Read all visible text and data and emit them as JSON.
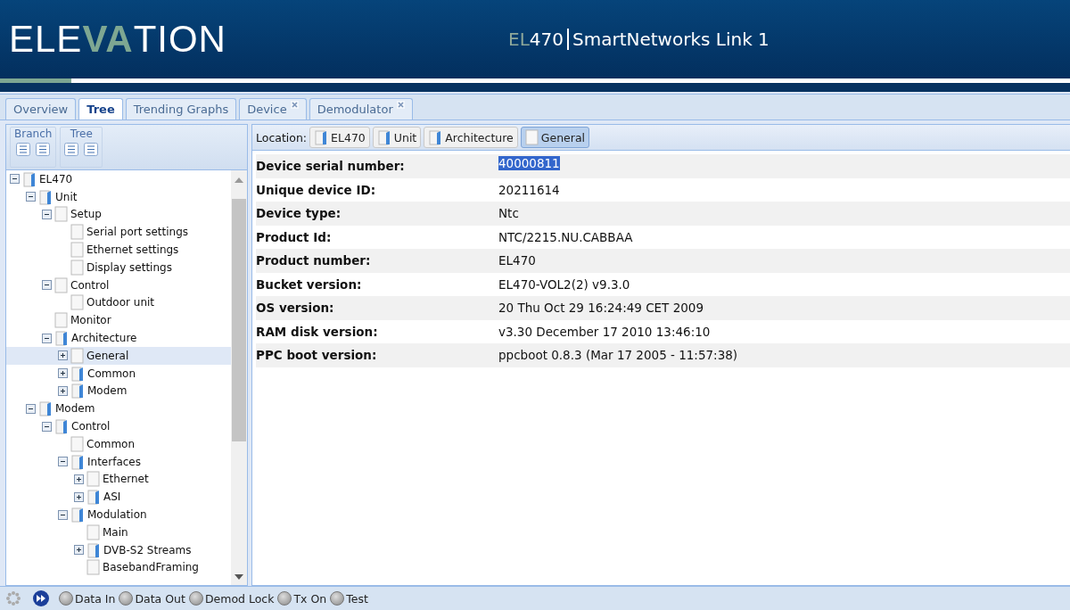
{
  "header": {
    "logo": [
      {
        "text": "ELE",
        "accent": false
      },
      {
        "text": "VA",
        "accent": true
      },
      {
        "text": "TION",
        "accent": false
      }
    ],
    "product": [
      {
        "text": "EL",
        "accent": true
      },
      {
        "text": "470",
        "accent": false
      }
    ],
    "title": "SmartNetworks Link 1"
  },
  "tabs": [
    {
      "label": "Overview",
      "selected": false,
      "closable": false
    },
    {
      "label": "Tree",
      "selected": true,
      "closable": false
    },
    {
      "label": "Trending Graphs",
      "selected": false,
      "closable": false
    },
    {
      "label": "Device",
      "selected": false,
      "closable": true
    },
    {
      "label": "Demodulator",
      "selected": false,
      "closable": true
    }
  ],
  "toolbar_groups": [
    {
      "label": "Branch"
    },
    {
      "label": "Tree"
    }
  ],
  "tree": [
    {
      "label": "EL470",
      "kind": "folder",
      "expanded": true,
      "selected": false,
      "children": [
        {
          "label": "Unit",
          "kind": "folder",
          "expanded": true,
          "selected": false,
          "children": [
            {
              "label": "Setup",
              "kind": "page",
              "expanded": true,
              "selected": false,
              "children": [
                {
                  "label": "Serial port settings",
                  "kind": "page",
                  "selected": false
                },
                {
                  "label": "Ethernet settings",
                  "kind": "page",
                  "selected": false
                },
                {
                  "label": "Display settings",
                  "kind": "page",
                  "selected": false
                }
              ]
            },
            {
              "label": "Control",
              "kind": "page",
              "expanded": true,
              "selected": false,
              "children": [
                {
                  "label": "Outdoor unit",
                  "kind": "page",
                  "selected": false
                }
              ]
            },
            {
              "label": "Monitor",
              "kind": "page",
              "selected": false
            },
            {
              "label": "Architecture",
              "kind": "folder",
              "expanded": true,
              "selected": false,
              "children": [
                {
                  "label": "General",
                  "kind": "page",
                  "expanded": false,
                  "selected": true
                },
                {
                  "label": "Common",
                  "kind": "folder",
                  "expanded": false,
                  "selected": false
                },
                {
                  "label": "Modem",
                  "kind": "folder",
                  "expanded": false,
                  "selected": false
                }
              ]
            }
          ]
        },
        {
          "label": "Modem",
          "kind": "folder",
          "expanded": true,
          "selected": false,
          "children": [
            {
              "label": "Control",
              "kind": "folder",
              "expanded": true,
              "selected": false,
              "children": [
                {
                  "label": "Common",
                  "kind": "page",
                  "selected": false
                },
                {
                  "label": "Interfaces",
                  "kind": "folder",
                  "expanded": true,
                  "selected": false,
                  "children": [
                    {
                      "label": "Ethernet",
                      "kind": "page",
                      "expanded": false,
                      "selected": false
                    },
                    {
                      "label": "ASI",
                      "kind": "folder",
                      "expanded": false,
                      "selected": false
                    }
                  ]
                },
                {
                  "label": "Modulation",
                  "kind": "folder",
                  "expanded": true,
                  "selected": false,
                  "children": [
                    {
                      "label": "Main",
                      "kind": "page",
                      "selected": false
                    },
                    {
                      "label": "DVB-S2 Streams",
                      "kind": "folder",
                      "expanded": false,
                      "selected": false
                    },
                    {
                      "label": "BasebandFraming",
                      "kind": "page",
                      "selected": false
                    }
                  ]
                }
              ]
            }
          ]
        }
      ]
    }
  ],
  "location": {
    "label": "Location:",
    "crumbs": [
      {
        "label": "EL470",
        "kind": "folder",
        "selected": false
      },
      {
        "label": "Unit",
        "kind": "folder",
        "selected": false
      },
      {
        "label": "Architecture",
        "kind": "folder",
        "selected": false
      },
      {
        "label": "General",
        "kind": "page",
        "selected": true
      }
    ]
  },
  "properties": [
    {
      "name": "Device serial number:",
      "value": "40000811",
      "selected": true
    },
    {
      "name": "Unique device ID:",
      "value": "20211614",
      "selected": false
    },
    {
      "name": "Device type:",
      "value": "Ntc",
      "selected": false
    },
    {
      "name": "Product Id:",
      "value": "NTC/2215.NU.CABBAA",
      "selected": false
    },
    {
      "name": "Product number:",
      "value": "EL470",
      "selected": false
    },
    {
      "name": "Bucket version:",
      "value": "EL470-VOL2(2) v9.3.0",
      "selected": false
    },
    {
      "name": "OS version:",
      "value": "20 Thu Oct 29 16:24:49 CET 2009",
      "selected": false
    },
    {
      "name": "RAM disk version:",
      "value": "v3.30 December 17 2010 13:46:10",
      "selected": false
    },
    {
      "name": "PPC boot version:",
      "value": "ppcboot 0.8.3 (Mar 17 2005 - 11:57:38)",
      "selected": false
    }
  ],
  "status_indicators": [
    {
      "label": "Data In",
      "on": false
    },
    {
      "label": "Data Out",
      "on": false
    },
    {
      "label": "Demod Lock",
      "on": false
    },
    {
      "label": "Tx On",
      "on": false
    },
    {
      "label": "Test",
      "on": false
    }
  ]
}
